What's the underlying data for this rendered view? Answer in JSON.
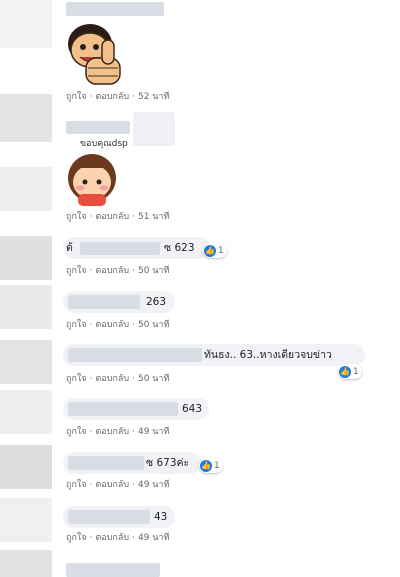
{
  "ui": {
    "like_label": "ถูกใจ",
    "reply_label": "ตอบกลับ",
    "separator": "·"
  },
  "comments": [
    {
      "type": "sticker",
      "sticker": "thumbs-up-face-sticker",
      "time": "52 นาที"
    },
    {
      "type": "sticker",
      "sticker": "shy-girl-sticker",
      "sticker_text": "ขอบคุณdsp",
      "time": "51 นาที"
    },
    {
      "type": "text",
      "prefix": "ต้",
      "text": "ซ 623",
      "reactions": "1",
      "time": "50 นาที"
    },
    {
      "type": "text",
      "text": "263",
      "time": "50 นาที"
    },
    {
      "type": "text",
      "text": "ทันธง.. 63..หางเดียวจบข่าว",
      "reactions": "1",
      "time": "50 นาที"
    },
    {
      "type": "text",
      "text": "643",
      "time": "49 นาที"
    },
    {
      "type": "text",
      "text": "ซ 673ค่ะ",
      "reactions": "1",
      "time": "49 นาที"
    },
    {
      "type": "text",
      "text": "43",
      "time": "49 นาที"
    }
  ],
  "colors": {
    "accent": "#1877f2",
    "bubble": "#f0f2f5",
    "meta": "#65676b"
  }
}
